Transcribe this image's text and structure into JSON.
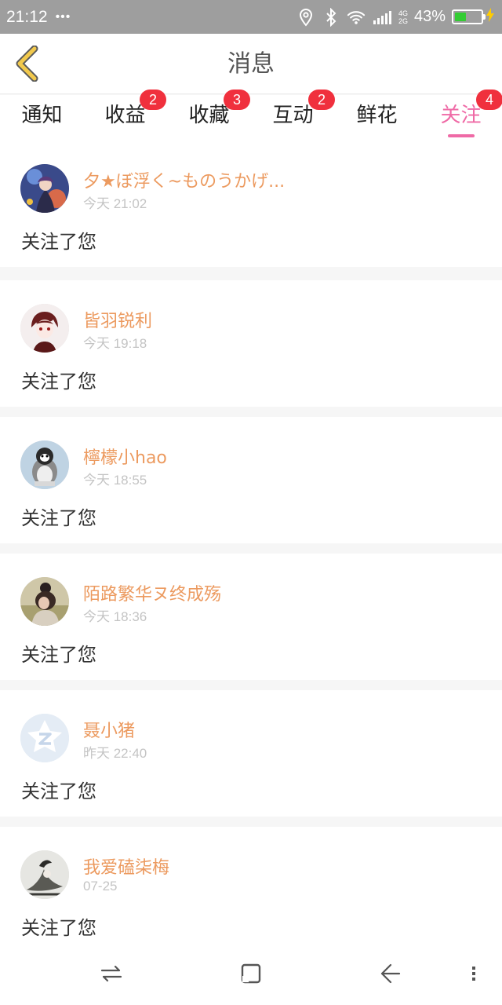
{
  "status_bar": {
    "time": "21:12",
    "dots": "•••",
    "net_top": "4G",
    "net_bottom": "2G",
    "battery_percent": "43%",
    "battery_level": 0.43,
    "battery_color": "#33cc33"
  },
  "header": {
    "title": "消息",
    "back_icon": "chevron-left-icon",
    "back_color": "#f2c94c"
  },
  "tabs": [
    {
      "label": "通知",
      "badge": ""
    },
    {
      "label": "收益",
      "badge": "2"
    },
    {
      "label": "收藏",
      "badge": "3"
    },
    {
      "label": "互动",
      "badge": "2"
    },
    {
      "label": "鲜花",
      "badge": ""
    },
    {
      "label": "关注",
      "badge": "4",
      "active": true
    }
  ],
  "accent_color": "#ef6aa6",
  "badge_color": "#f0303d",
  "name_color": "#ec9a5f",
  "messages": [
    {
      "name": "夕★ぼ浮く~ものうかげ...",
      "time": "今天 21:02",
      "text": "关注了您",
      "avatar": "anime-girl-avatar"
    },
    {
      "name": "皆羽锐利",
      "time": "今天 19:18",
      "text": "关注了您",
      "avatar": "anime-boy-avatar"
    },
    {
      "name": "檸檬小hao",
      "time": "今天 18:55",
      "text": "关注了您",
      "avatar": "penguin-avatar"
    },
    {
      "name": "陌路繁华ヌ终成殇",
      "time": "今天 18:36",
      "text": "关注了您",
      "avatar": "girl-photo-avatar"
    },
    {
      "name": "聂小猪",
      "time": "昨天 22:40",
      "text": "关注了您",
      "avatar": "default-z-avatar"
    },
    {
      "name": "我爱磕柒梅",
      "time": "07-25",
      "text": "关注了您",
      "avatar": "ink-sketch-avatar"
    }
  ],
  "nav_bar": {
    "icons": [
      "switch-apps-icon",
      "home-icon",
      "back-icon",
      "menu-icon"
    ]
  }
}
